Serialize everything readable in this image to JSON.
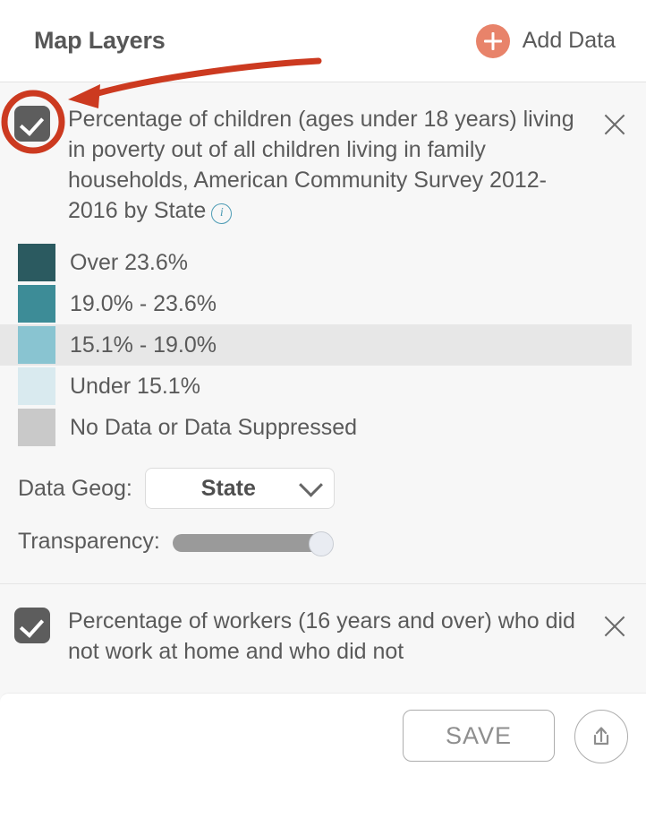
{
  "header": {
    "title": "Map Layers",
    "add_data_label": "Add Data",
    "add_data_icon": "plus-circle-icon",
    "accent_color": "#e8836a"
  },
  "layers": [
    {
      "checked": true,
      "checkbox_icon": "checkmark-icon",
      "title": "Percentage of children (ages under 18 years) living in poverty out of all children living in family households, American Community Survey 2012-2016 by State",
      "info_icon": "info-circle-icon",
      "info_glyph": "i",
      "close_icon": "close-x-icon",
      "legend": [
        {
          "label": "Over 23.6%",
          "color": "#2b5a60",
          "highlighted": false
        },
        {
          "label": "19.0% - 23.6%",
          "color": "#3d8c97",
          "highlighted": false
        },
        {
          "label": "15.1% - 19.0%",
          "color": "#89c4d1",
          "highlighted": true
        },
        {
          "label": "Under 15.1%",
          "color": "#d9eaef",
          "highlighted": false
        },
        {
          "label": "No Data or Data Suppressed",
          "color": "#c9c9c9",
          "highlighted": false
        }
      ],
      "data_geog": {
        "label": "Data Geog:",
        "value": "State",
        "chevron_icon": "chevron-down-icon"
      },
      "transparency": {
        "label": "Transparency:",
        "value": 100
      }
    },
    {
      "checked": true,
      "checkbox_icon": "checkmark-icon",
      "title": "Percentage of workers (16 years and over) who did not work at home and who did not",
      "close_icon": "close-x-icon"
    }
  ],
  "footer": {
    "save_label": "SAVE",
    "share_icon": "share-upload-icon"
  },
  "annotations": {
    "arrow_color": "#cc3a20",
    "circle_color": "#cc3a20",
    "arrow_target": "layer-1-checkbox"
  }
}
